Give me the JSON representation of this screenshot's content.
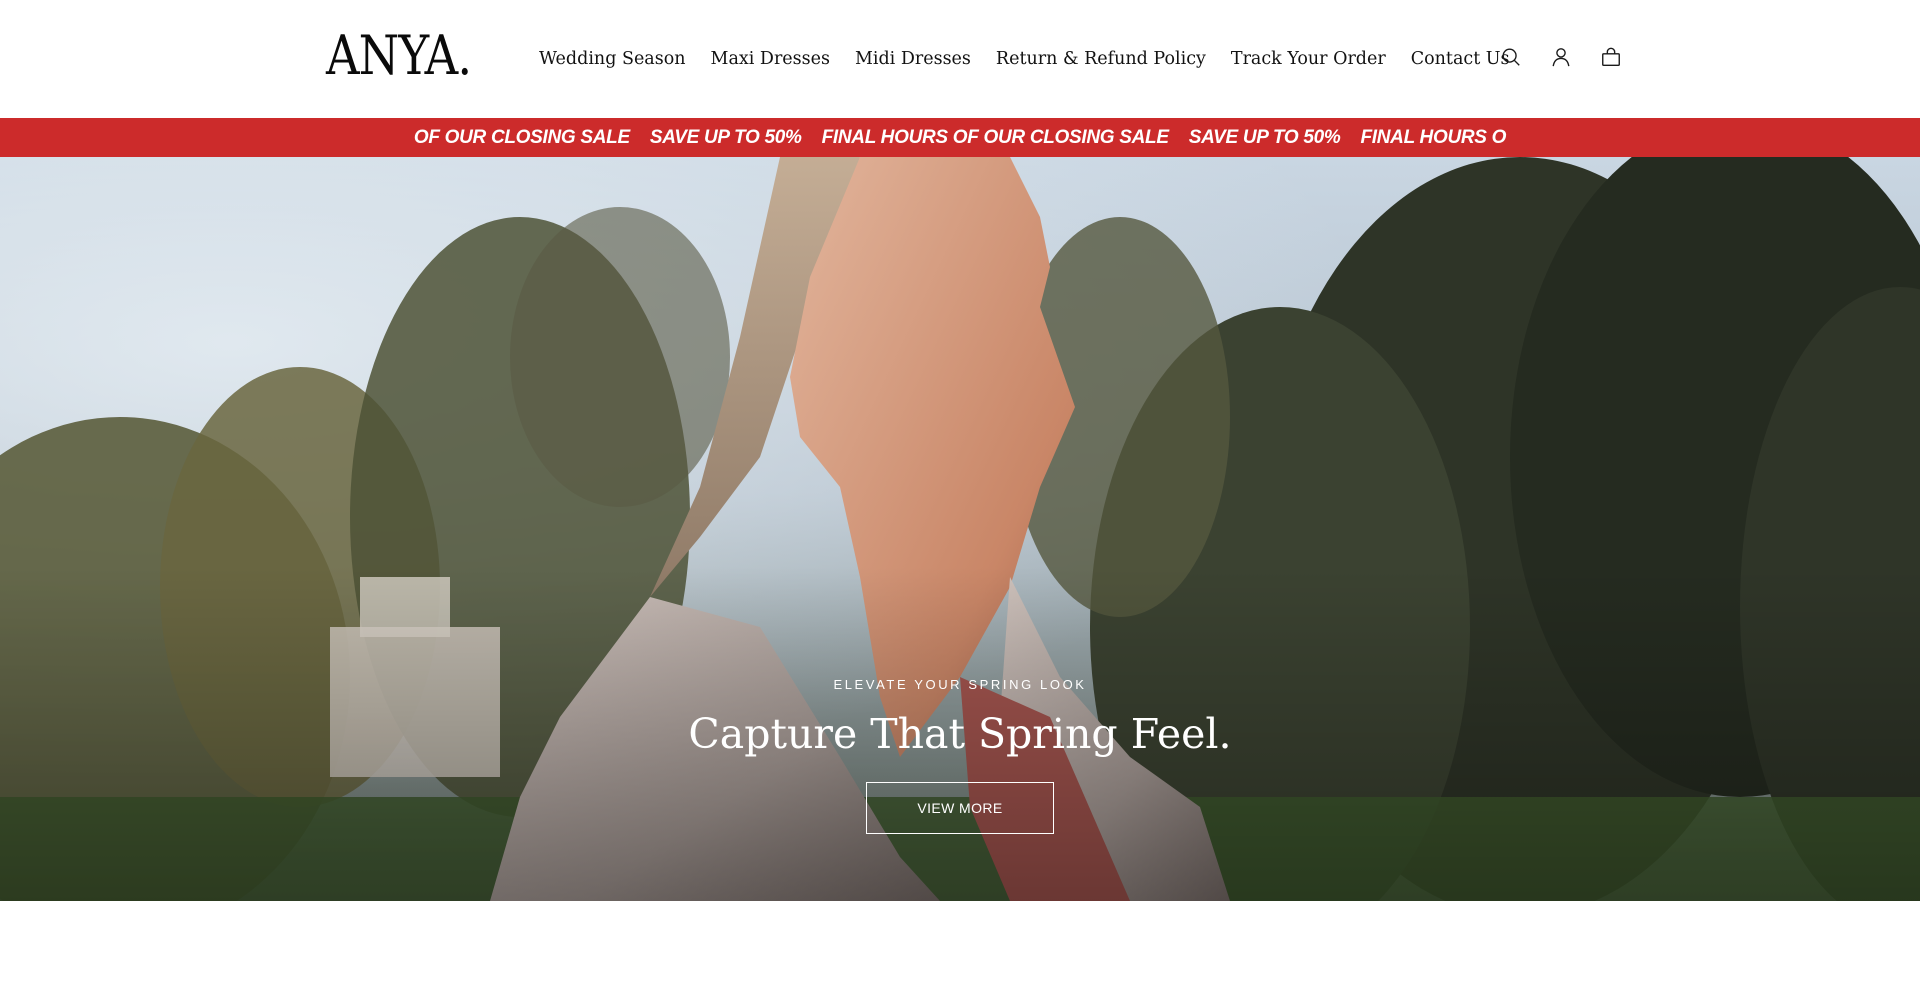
{
  "header": {
    "logo": "ANYA.",
    "nav": [
      {
        "label": "Wedding Season"
      },
      {
        "label": "Maxi Dresses"
      },
      {
        "label": "Midi Dresses"
      },
      {
        "label": "Return & Refund Policy"
      },
      {
        "label": "Track Your Order"
      },
      {
        "label": "Contact Us"
      }
    ],
    "icons": [
      "search-icon",
      "account-icon",
      "cart-icon"
    ]
  },
  "announcement": {
    "background": "#cc2b2b",
    "items": [
      "OF OUR CLOSING SALE",
      "SAVE UP TO 50%",
      "FINAL HOURS OF OUR CLOSING SALE",
      "SAVE UP TO 50%",
      "FINAL HOURS O"
    ]
  },
  "hero": {
    "subheading": "ELEVATE YOUR SPRING LOOK",
    "heading": "Capture That Spring Feel.",
    "button_label": "VIEW MORE"
  }
}
